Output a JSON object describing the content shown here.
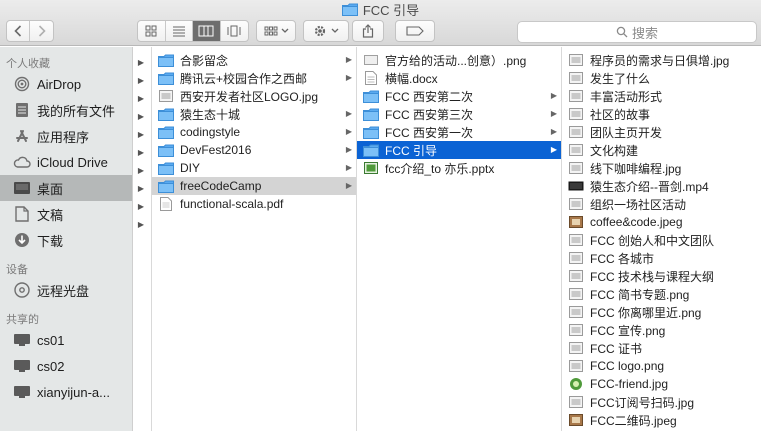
{
  "window": {
    "title": "FCC 引导"
  },
  "toolbar": {
    "search_placeholder": "搜索"
  },
  "sidebar": {
    "sections": [
      {
        "title": "个人收藏",
        "items": [
          {
            "label": "AirDrop",
            "icon": "airdrop-icon"
          },
          {
            "label": "我的所有文件",
            "icon": "all-files-icon"
          },
          {
            "label": "应用程序",
            "icon": "applications-icon"
          },
          {
            "label": "iCloud Drive",
            "icon": "cloud-icon"
          },
          {
            "label": "桌面",
            "icon": "desktop-icon",
            "selected": true
          },
          {
            "label": "文稿",
            "icon": "document-icon"
          },
          {
            "label": "下载",
            "icon": "download-icon"
          }
        ]
      },
      {
        "title": "设备",
        "items": [
          {
            "label": "远程光盘",
            "icon": "disc-icon"
          }
        ]
      },
      {
        "title": "共享的",
        "items": [
          {
            "label": "cs01",
            "icon": "monitor-icon"
          },
          {
            "label": "cs02",
            "icon": "monitor-icon"
          },
          {
            "label": "xianyijun-a...",
            "icon": "monitor-icon"
          }
        ]
      }
    ]
  },
  "columns": [
    {
      "rows": [
        {
          "label": "",
          "disc": true
        },
        {
          "label": "",
          "disc": true
        },
        {
          "label": "",
          "disc": true
        },
        {
          "label": "",
          "disc": true
        },
        {
          "label": "",
          "disc": true
        },
        {
          "label": "",
          "disc": true
        },
        {
          "label": "",
          "disc": true
        },
        {
          "label": "",
          "disc": true
        },
        {
          "label": "",
          "disc": true
        },
        {
          "label": "",
          "disc": true
        }
      ]
    },
    {
      "rows": [
        {
          "label": "合影留念",
          "type": "folder",
          "arrow": true
        },
        {
          "label": "腾讯云+校园合作之西邮",
          "type": "folder",
          "arrow": true
        },
        {
          "label": "西安开发者社区LOGO.jpg",
          "type": "image"
        },
        {
          "label": "猿生态十城",
          "type": "folder",
          "arrow": true
        },
        {
          "label": "codingstyle",
          "type": "folder",
          "arrow": true
        },
        {
          "label": "DevFest2016",
          "type": "folder",
          "arrow": true
        },
        {
          "label": "DIY",
          "type": "folder",
          "arrow": true
        },
        {
          "label": "freeCodeCamp",
          "type": "folder",
          "arrow": true,
          "state": "dim"
        },
        {
          "label": "functional-scala.pdf",
          "type": "pdf"
        }
      ]
    },
    {
      "rows": [
        {
          "label": "官方给的活动...创意）.png",
          "type": "file"
        },
        {
          "label": "横幅.docx",
          "type": "doc"
        },
        {
          "label": "FCC 西安第二次",
          "type": "folder",
          "arrow": true
        },
        {
          "label": "FCC 西安第三次",
          "type": "folder",
          "arrow": true
        },
        {
          "label": "FCC 西安第一次",
          "type": "folder",
          "arrow": true
        },
        {
          "label": "FCC 引导",
          "type": "folder",
          "arrow": true,
          "state": "sel"
        },
        {
          "label": "fcc介绍_to 亦乐.pptx",
          "type": "pptx"
        }
      ]
    },
    {
      "rows": [
        {
          "label": "程序员的需求与日俱增.jpg",
          "type": "image"
        },
        {
          "label": "发生了什么",
          "type": "image"
        },
        {
          "label": "丰富活动形式",
          "type": "image"
        },
        {
          "label": "社区的故事",
          "type": "image"
        },
        {
          "label": "团队主页开发",
          "type": "image"
        },
        {
          "label": "文化构建",
          "type": "image"
        },
        {
          "label": "线下咖啡编程.jpg",
          "type": "image"
        },
        {
          "label": "猿生态介绍--晋剑.mp4",
          "type": "video"
        },
        {
          "label": "组织一场社区活动",
          "type": "image"
        },
        {
          "label": "coffee&code.jpeg",
          "type": "photo"
        },
        {
          "label": "FCC 创始人和中文团队",
          "type": "image"
        },
        {
          "label": "FCC 各城市",
          "type": "image"
        },
        {
          "label": "FCC 技术栈与课程大纲",
          "type": "image"
        },
        {
          "label": "FCC 简书专题.png",
          "type": "image"
        },
        {
          "label": "FCC 你离哪里近.png",
          "type": "image"
        },
        {
          "label": "FCC 宣传.png",
          "type": "image"
        },
        {
          "label": "FCC 证书",
          "type": "image"
        },
        {
          "label": "FCC logo.png",
          "type": "image"
        },
        {
          "label": "FCC-friend.jpg",
          "type": "green"
        },
        {
          "label": "FCC订阅号扫码.jpg",
          "type": "image"
        },
        {
          "label": "FCC二维码.jpeg",
          "type": "photo"
        }
      ]
    }
  ]
}
